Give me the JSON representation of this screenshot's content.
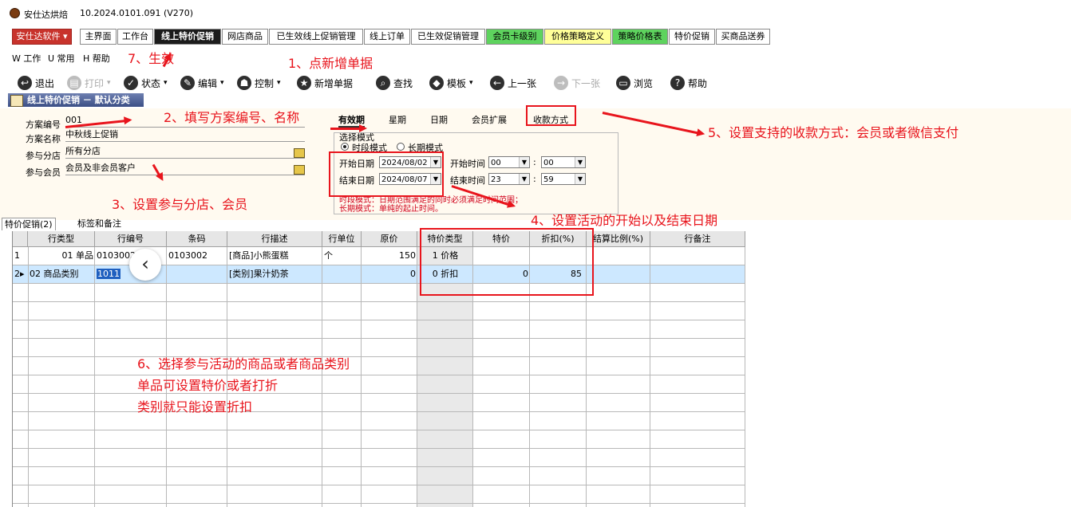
{
  "window": {
    "title": "安仕达烘焙",
    "version": "10.2024.0101.091 (V270)"
  },
  "tabs": [
    {
      "label": "安仕达软件 ▾",
      "style": "brand"
    },
    {
      "label": "主界面",
      "style": "normal"
    },
    {
      "label": "工作台",
      "style": "normal"
    },
    {
      "label": "线上特价促销",
      "style": "active"
    },
    {
      "label": "网店商品",
      "style": "normal"
    },
    {
      "label": "已生效线上促销管理",
      "style": "normal"
    },
    {
      "label": "线上订单",
      "style": "normal"
    },
    {
      "label": "已生效促销管理",
      "style": "normal"
    },
    {
      "label": "会员卡级别",
      "style": "green"
    },
    {
      "label": "价格策略定义",
      "style": "yellow"
    },
    {
      "label": "策略价格表",
      "style": "green"
    },
    {
      "label": "特价促销",
      "style": "normal"
    },
    {
      "label": "买商品送券",
      "style": "normal"
    }
  ],
  "menu": {
    "work": "W 工作",
    "common": "U 常用",
    "help": "H 帮助"
  },
  "toolbar": {
    "exit": "退出",
    "print": "打印",
    "status": "状态",
    "edit": "编辑",
    "control": "控制",
    "new": "新增单据",
    "find": "查找",
    "template": "模板",
    "prev": "上一张",
    "next": "下一张",
    "browse": "浏览",
    "help": "帮助"
  },
  "module_header": "线上特价促销 － 默认分类",
  "form": {
    "plan_no_label": "方案编号",
    "plan_no": "001",
    "plan_name_label": "方案名称",
    "plan_name": "中秋线上促销",
    "branch_label": "参与分店",
    "branch": "所有分店",
    "member_label": "参与会员",
    "member": "会员及非会员客户"
  },
  "panel_tabs": [
    "有效期",
    "星期",
    "日期",
    "会员扩展",
    "收款方式"
  ],
  "period": {
    "group_title": "选择模式",
    "mode_time": "时段模式",
    "mode_long": "长期模式",
    "start_date_label": "开始日期",
    "start_date": "2024/08/02",
    "end_date_label": "结束日期",
    "end_date": "2024/08/07",
    "start_time_label": "开始时间",
    "start_hour": "00",
    "start_min": "00",
    "end_time_label": "结束时间",
    "end_hour": "23",
    "end_min": "59",
    "colon": ":",
    "note1": "时段模式：日期范围满足的同时必须满足时间范围；",
    "note2": "长期模式：单纯的起止时间。"
  },
  "grid_tabs": [
    "特价促销(2)",
    "标签和备注"
  ],
  "grid": {
    "columns": [
      "行类型",
      "行编号",
      "条码",
      "行描述",
      "行单位",
      "原价",
      "特价类型",
      "特价",
      "折扣(%)",
      "结算比例(%)",
      "行备注"
    ],
    "rows": [
      {
        "idx": "1",
        "type": "01 单品",
        "code": "0103002",
        "barcode": "0103002",
        "desc": "[商品]小熊蛋糕",
        "unit": "个",
        "price": "150",
        "ptype": "1 价格",
        "special": "",
        "discount": "",
        "ratio": "",
        "note": ""
      },
      {
        "idx": "2▸",
        "type": "02 商品类别",
        "code": "1011",
        "barcode": "",
        "desc": "[类别]果汁奶茶",
        "unit": "",
        "price": "0",
        "ptype": "0 折扣",
        "special": "0",
        "discount": "85",
        "ratio": "",
        "note": ""
      }
    ]
  },
  "annotations": {
    "a1": "1、点新增单据",
    "a2": "2、填写方案编号、名称",
    "a3": "3、设置参与分店、会员",
    "a4": "4、设置活动的开始以及结束日期",
    "a5": "5、设置支持的收款方式：会员或者微信支付",
    "a6_line1": "6、选择参与活动的商品或者商品类别",
    "a6_line2": "单品可设置特价或者打折",
    "a6_line3": "类别就只能设置折扣",
    "a7": "7、生效"
  },
  "colors": {
    "annotation": "#e8141c",
    "brand": "#c8332c",
    "selected_row": "#cde8ff",
    "panel_bg": "#fffaf0"
  }
}
